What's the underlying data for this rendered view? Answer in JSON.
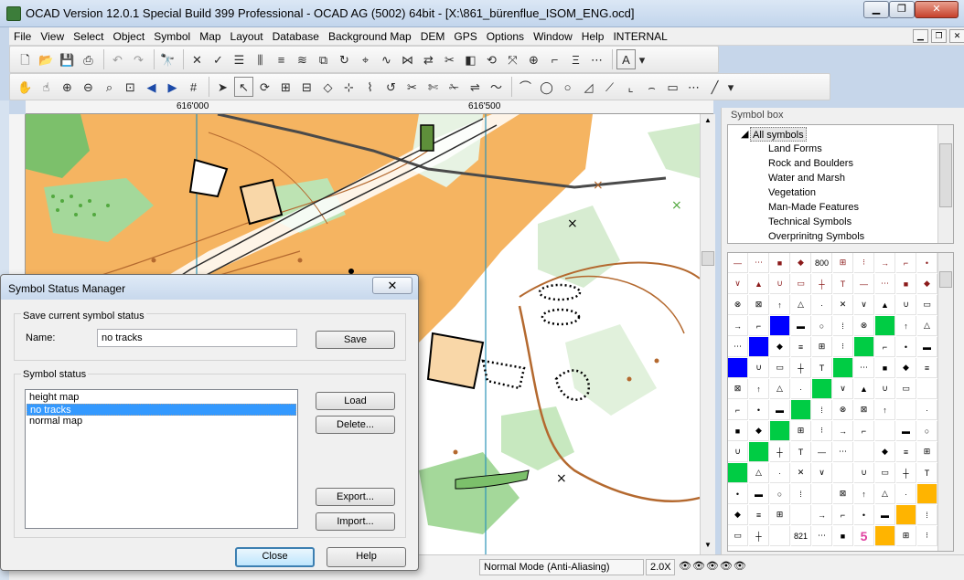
{
  "window": {
    "title": "OCAD Version 12.0.1  Special Build 399  Professional - OCAD AG (5002) 64bit - [X:\\861_bürenflue_ISOM_ENG.ocd]"
  },
  "menu": [
    "File",
    "View",
    "Select",
    "Object",
    "Symbol",
    "Map",
    "Layout",
    "Database",
    "Background Map",
    "DEM",
    "GPS",
    "Options",
    "Window",
    "Help",
    "INTERNAL"
  ],
  "ruler": {
    "x_labels": [
      "616'000",
      "616'500"
    ]
  },
  "symbol_box": {
    "title": "Symbol box",
    "tree": {
      "root": "All symbols",
      "children": [
        "Land Forms",
        "Rock and Boulders",
        "Water and Marsh",
        "Vegetation",
        "Man-Made Features",
        "Technical Symbols",
        "Overprinitng Symbols"
      ]
    },
    "sample_labels": [
      "800",
      "821",
      "5"
    ]
  },
  "dialog": {
    "title": "Symbol Status Manager",
    "save_group": {
      "label": "Save current symbol status",
      "name_label": "Name:",
      "name_value": "no tracks",
      "save_button": "Save"
    },
    "status_group": {
      "label": "Symbol status",
      "items": [
        "height map",
        "no tracks",
        "normal map"
      ],
      "selected_index": 1,
      "load_button": "Load",
      "delete_button": "Delete...",
      "export_button": "Export...",
      "import_button": "Import..."
    },
    "close_button": "Close",
    "help_button": "Help"
  },
  "status_bar": {
    "mode": "Normal Mode (Anti-Aliasing)",
    "zoom": "2.0X"
  },
  "colors": {
    "map_orange": "#f5b461",
    "map_green": "#a4d89a",
    "map_brown": "#b4692f",
    "map_blue_line": "#2c94b8",
    "selection": "#3399ff"
  }
}
